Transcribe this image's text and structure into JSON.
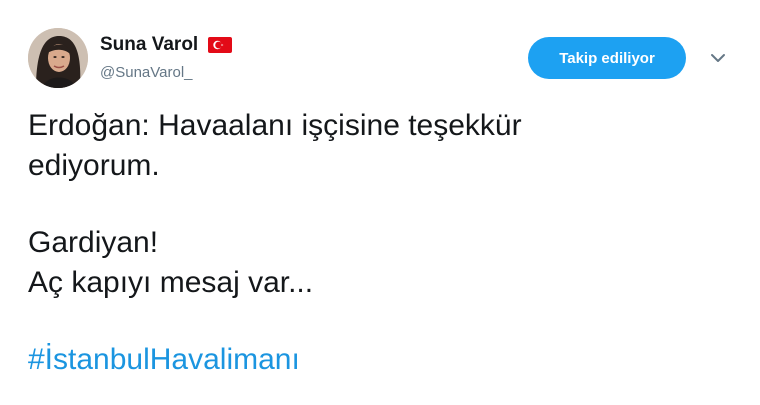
{
  "author": {
    "display_name": "Suna Varol",
    "handle": "@SunaVarol_",
    "flag_icon": "turkey-flag-icon"
  },
  "actions": {
    "follow_label": "Takip ediliyor",
    "menu_icon": "chevron-down-icon"
  },
  "tweet": {
    "line1": "Erdoğan: Havaalanı işçisine teşekkür",
    "line2": "ediyorum.",
    "line3": "Gardiyan!",
    "line4": "Aç kapıyı mesaj var...",
    "hashtag": "#İstanbulHavalimanı"
  },
  "colors": {
    "accent": "#1da1f2",
    "link": "#1b95e0",
    "muted": "#657786",
    "flag_red": "#e30a17"
  }
}
